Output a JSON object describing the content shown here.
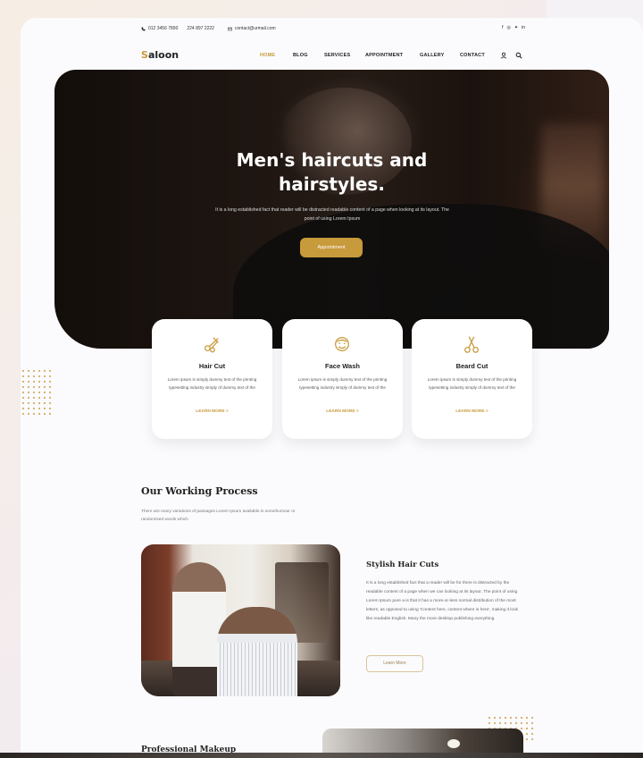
{
  "topbar": {
    "phones": "012 3456 7890 · 224 897 2222",
    "phone1": "012 3456 7890",
    "phone2": "224 897 2222",
    "email": "contact@urmail.com",
    "social_icons": [
      "facebook-icon",
      "instagram-icon",
      "twitter-icon",
      "linkedin-icon"
    ]
  },
  "nav": {
    "logo_first": "S",
    "logo_rest": "aloon",
    "items": [
      "HOME",
      "BLOG",
      "SERVICES",
      "APPOINTMENT",
      "GALLERY",
      "CONTACT"
    ],
    "active": "HOME"
  },
  "hero": {
    "title_line1": "Men's haircuts and",
    "title_line2": "hairstyles.",
    "subtitle": "It is a long established fact that reader will be distracted readable content of a page when looking at its layout. The point of using Lorem Ipsum",
    "cta_label": "Appointment"
  },
  "services": [
    {
      "title": "Hair Cut",
      "text": "Lorem ipsum is simply dummy text of the printing typesetting industry simply of dummy text of the",
      "link": "LEARN MORE >"
    },
    {
      "title": "Face Wash",
      "text": "Lorem ipsum is simply dummy text of the printing typesetting industry simply of dummy text of the",
      "link": "LEARN MORE >"
    },
    {
      "title": "Beard Cut",
      "text": "Lorem ipsum is simply dummy text of the printing typesetting industry simply of dummy text of the",
      "link": "LEARN MORE >"
    }
  ],
  "process": {
    "title": "Our Working Process",
    "subtitle": "There are many variations of passages Lorem Ipsum available in somehumour or randomised words which"
  },
  "stylish": {
    "title": "Stylish Hair Cuts",
    "text": "It is a long established fact that a reader will be for there is distracted by the readable content of a page when we can looking at its layout. The point of using Lorem Ipsum pure a is that it has a more-or-less normal distribution of the most letters, as opposed to using 'Content here, content where is here', making it look like readable English. Many the more desktop publishing everything",
    "button": "Learn More"
  },
  "makeup": {
    "title": "Professional Makeup"
  },
  "colors": {
    "accent": "#c79a3b",
    "dark": "#222222"
  }
}
